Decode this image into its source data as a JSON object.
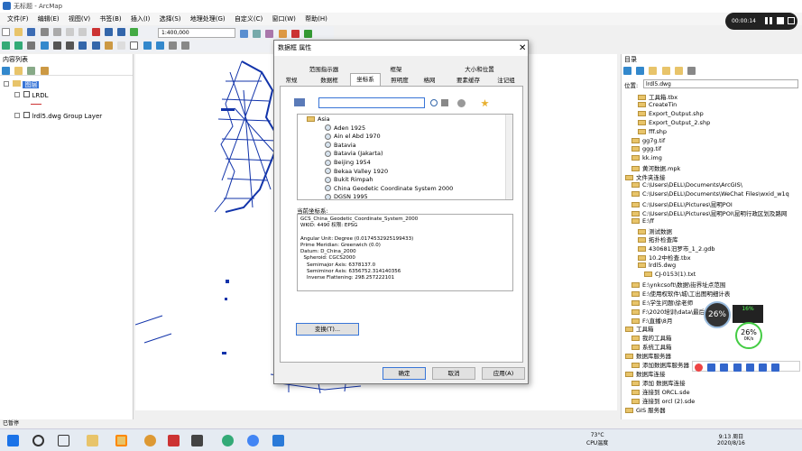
{
  "app": {
    "title": "无标题 - ArcMap"
  },
  "menu": [
    "文件(F)",
    "编辑(E)",
    "视图(V)",
    "书签(B)",
    "插入(I)",
    "选择(S)",
    "地理处理(G)",
    "自定义(C)",
    "窗口(W)",
    "帮助(H)"
  ],
  "toolbar": {
    "scale_value": "1:400,000"
  },
  "recorder": {
    "time": "00:00:14"
  },
  "toc": {
    "title": "内容列表",
    "root": "图层",
    "layers": [
      "LRDL",
      "lrdl5.dwg Group Layer"
    ]
  },
  "catalog": {
    "title": "目录",
    "location_label": "位置:",
    "location_value": "lrdl5.dwg",
    "items": [
      "工具箱.tbx",
      "CreateTin",
      "Export_Output.shp",
      "Export_Output_2.shp",
      "fff.shp",
      "gg7g.tif",
      "ggg.tif",
      "kk.img",
      "黄河数据.mpk",
      "文件夹连接",
      "C:\\Users\\DELL\\Documents\\ArcGIS\\",
      "C:\\Users\\DELL\\Documents\\WeChat Files\\wxid_w1q",
      "C:\\Users\\DELL\\Pictures\\昆明POI",
      "C:\\Users\\DELL\\Pictures\\昆明POI\\昆明行政区划及路网",
      "E:\\ff",
      "测试数据",
      "拓扑检查库",
      "430681汨罗市_1_2.gdb",
      "10.2中检查.tbx",
      "lrdl5.dwg",
      "CJ-0153(1).txt",
      "E:\\ynkcsoft\\数据\\街界址点范围",
      "E:\\使用权软件\\城\\工出图明细计表",
      "E:\\学生问题\\徐老师",
      "F:\\2020培训\\data\\最后",
      "F:\\直播\\8月",
      "工具箱",
      "我的工具箱",
      "系统工具箱",
      "数据库服务器",
      "添加数据库服务器",
      "数据库连接",
      "添加 数据库连接",
      "连接到 ORCL.sde",
      "连接到 orcl (2).sde",
      "GIS 服务器"
    ]
  },
  "overlay": {
    "cpu_percent": "26%",
    "badge_percent": "16%",
    "net_percent": "26%",
    "net_speed": "0K/s"
  },
  "dialog": {
    "title": "数据框 属性",
    "tabs_row1": [
      "范围指示器",
      "框架",
      "大小和位置"
    ],
    "tabs_row2": [
      "常规",
      "数据框",
      "坐标系",
      "照明度",
      "格网",
      "要素缓存",
      "注记组"
    ],
    "active_tab": "坐标系",
    "tree": [
      "Asia",
      "Aden 1925",
      "Ain el Abd 1970",
      "Batavia",
      "Batavia (Jakarta)",
      "Beijing 1954",
      "Bekaa Valley 1920",
      "Bukit Rimpah",
      "China Geodetic Coordinate System 2000",
      "DGSN 1995"
    ],
    "current_label": "当前坐标系:",
    "current_text": [
      "GCS_China_Geodetic_Coordinate_System_2000",
      "WKID: 4490 权限: EPSG",
      "",
      "Angular Unit: Degree (0.0174532925199433)",
      "Prime Meridian: Greenwich (0.0)",
      "Datum: D_China_2000",
      "  Spheroid: CGCS2000",
      "    Semimajor Axis: 6378137.0",
      "    Semiminor Axis: 6356752.314140356",
      "    Inverse Flattening: 298.257222101"
    ],
    "transform_button": "变换(T)...",
    "ok": "确定",
    "cancel": "取消",
    "apply": "应用(A)"
  },
  "status": {
    "text": "已暂停"
  },
  "taskbar": {
    "weather_temp": "73°C",
    "weather_text": "CPU温度",
    "time": "9:13 周日",
    "date": "2020/8/16"
  }
}
